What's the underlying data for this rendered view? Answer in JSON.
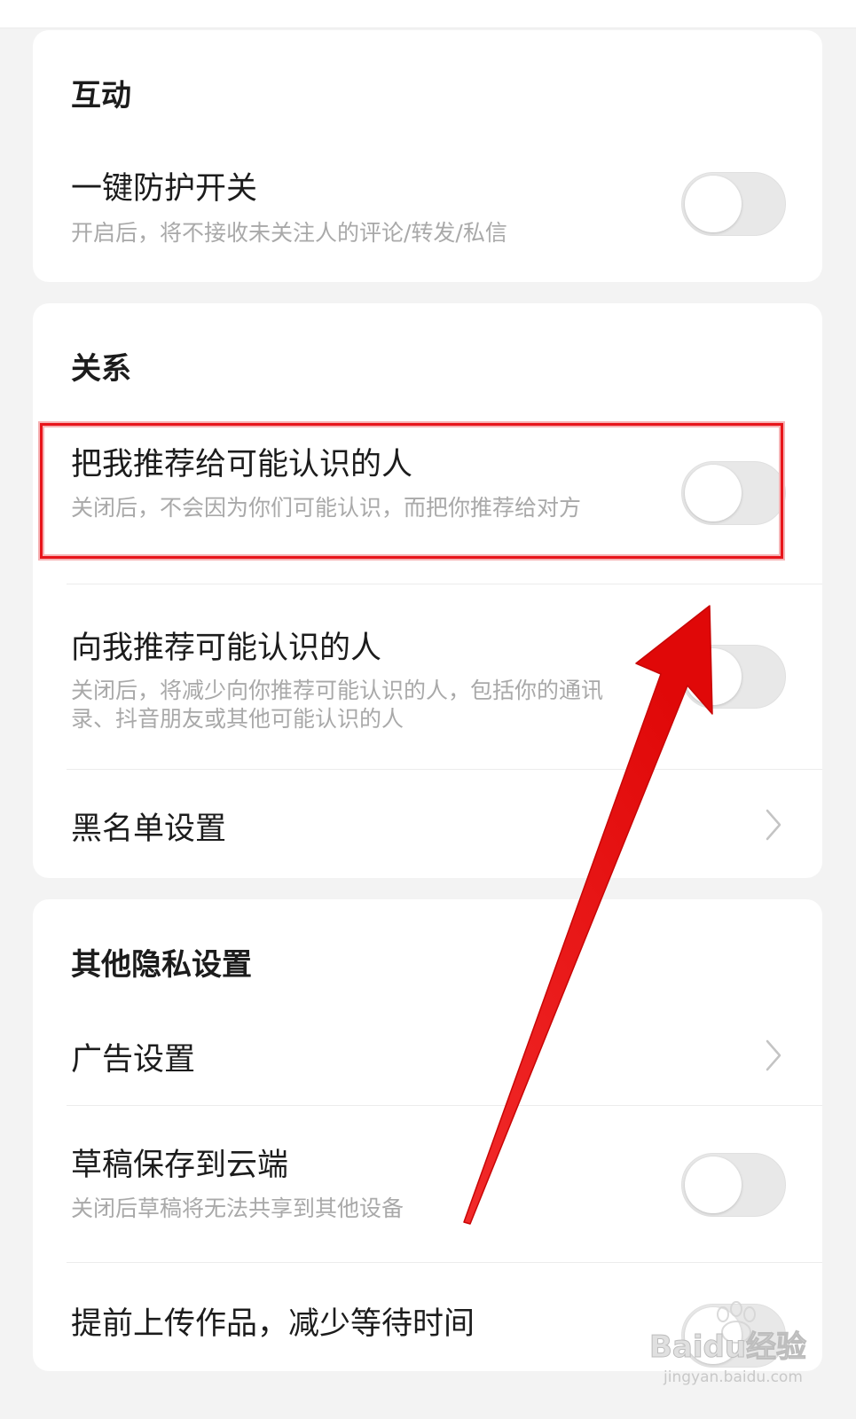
{
  "sections": {
    "interaction": {
      "title": "互动",
      "one_key_protection": {
        "title": "一键防护开关",
        "desc": "开启后，将不接收未关注人的评论/转发/私信",
        "enabled": false
      }
    },
    "relationship": {
      "title": "关系",
      "recommend_me": {
        "title": "把我推荐给可能认识的人",
        "desc": "关闭后，不会因为你们可能认识，而把你推荐给对方",
        "enabled": false
      },
      "recommend_to_me": {
        "title": "向我推荐可能认识的人",
        "desc": "关闭后，将减少向你推荐可能认识的人，包括你的通讯录、抖音朋友或其他可能认识的人",
        "enabled": false
      },
      "blacklist": {
        "title": "黑名单设置",
        "icon": "chevron-right-icon"
      }
    },
    "other_privacy": {
      "title": "其他隐私设置",
      "ads": {
        "title": "广告设置",
        "icon": "chevron-right-icon"
      },
      "draft_cloud": {
        "title": "草稿保存到云端",
        "desc": "关闭后草稿将无法共享到其他设备",
        "enabled": false
      },
      "early_upload": {
        "title": "提前上传作品，减少等待时间",
        "enabled": false
      }
    }
  },
  "annotation": {
    "highlight_color": "#e8141a",
    "arrow_color": "#ee0d0d"
  },
  "watermark": {
    "brand": "Baidu经验",
    "url": "jingyan.baidu.com"
  }
}
